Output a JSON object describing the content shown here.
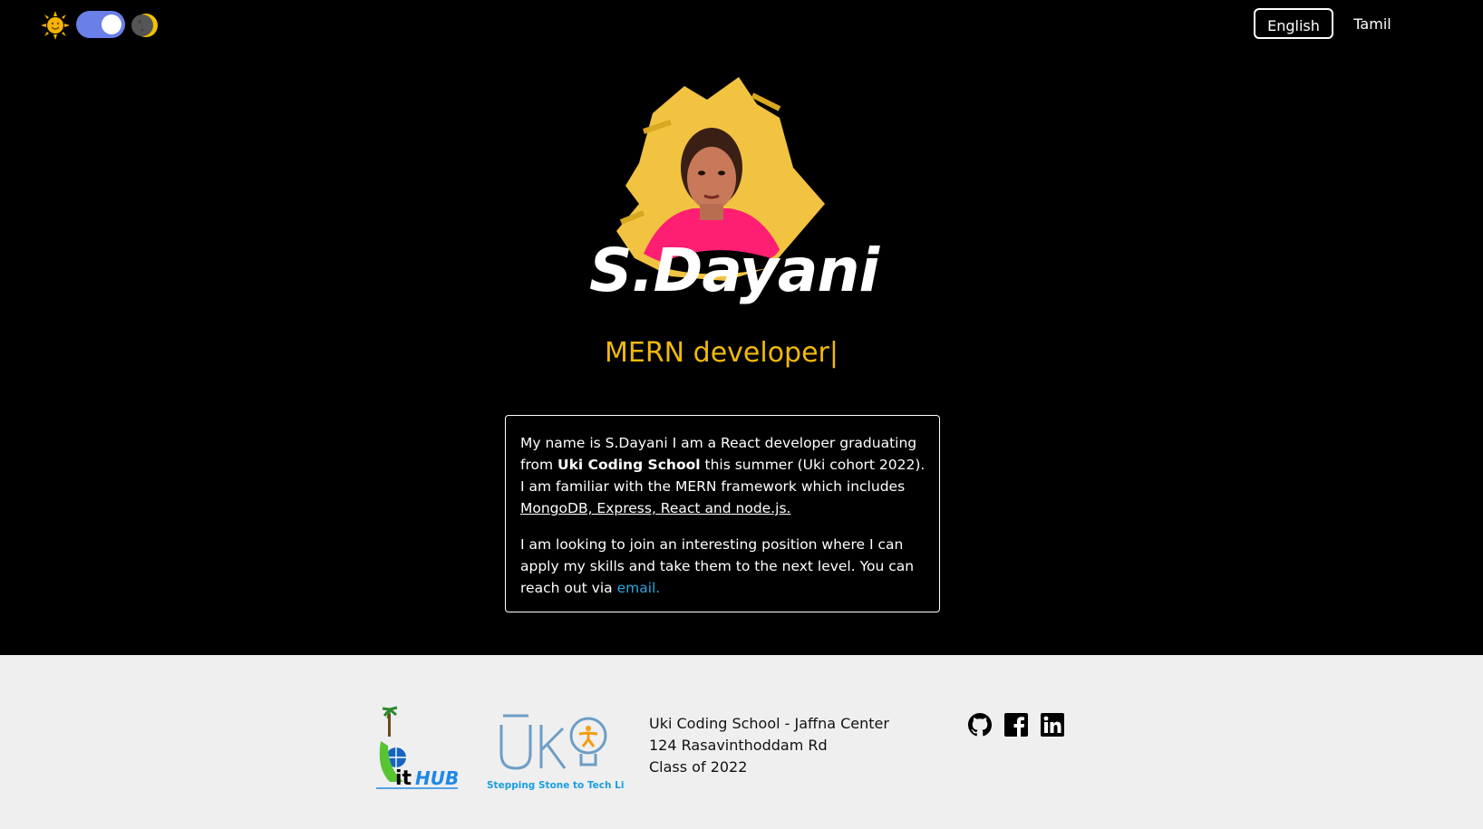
{
  "theme_toggle": {
    "sun_icon": "sun-icon",
    "moon_icon": "moon-icon",
    "state": "dark"
  },
  "languages": {
    "english": "English",
    "tamil": "Tamil",
    "active": "English"
  },
  "hero": {
    "name": "S.Dayani"
  },
  "role": "MERN developer|",
  "bio": {
    "p1_a": "My name is S.Dayani I am a React developer graduating from ",
    "p1_school": "Uki Coding School",
    "p1_b": " this summer (Uki cohort 2022). I am familiar with the MERN framework which includes ",
    "p1_stack": "MongoDB, Express, React and node.js.",
    "p2_a": "I am looking to join an interesting position where I can apply my skills and take them to the next level. You can reach out via ",
    "p2_email": "email."
  },
  "footer": {
    "ithub_logo_text": "itHUB",
    "uki_logo_text": "Uki",
    "uki_tagline": "Stepping Stone to Tech Life",
    "address": [
      "Uki Coding School - Jaffna Center",
      "124 Rasavinthoddam Rd",
      "Class of 2022"
    ],
    "social": [
      "github-icon",
      "facebook-icon",
      "linkedin-icon"
    ]
  },
  "colors": {
    "accent": "#f0b90b",
    "toggle": "#6a7fe8",
    "link": "#2aa9e0",
    "footer_bg": "#efefef"
  }
}
